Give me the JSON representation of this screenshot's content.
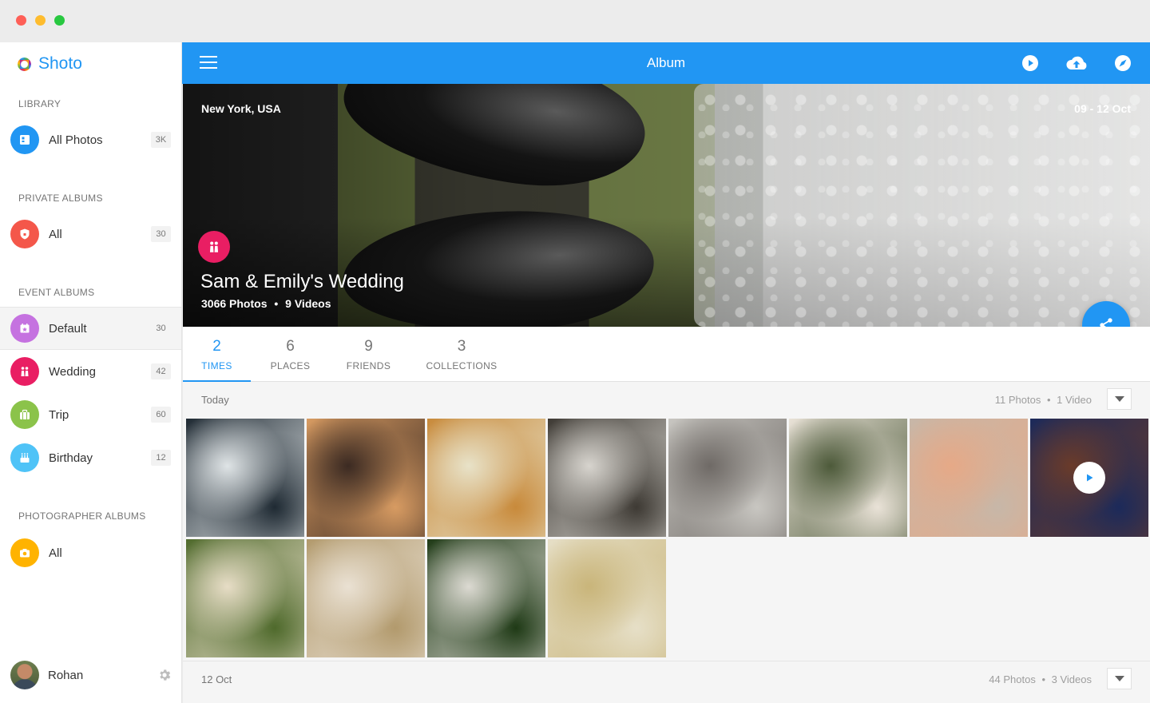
{
  "app": {
    "name": "Shoto"
  },
  "sidebar": {
    "sections": [
      {
        "label": "LIBRARY"
      },
      {
        "label": "PRIVATE ALBUMS"
      },
      {
        "label": "EVENT ALBUMS"
      },
      {
        "label": "PHOTOGRAPHER ALBUMS"
      }
    ],
    "items": [
      {
        "label": "All Photos",
        "count": "3K",
        "icon": "photos-icon",
        "color": "#2196f3"
      },
      {
        "label": "All",
        "count": "30",
        "icon": "shield-lock-icon",
        "color": "#f4574a"
      },
      {
        "label": "Default",
        "count": "30",
        "icon": "calendar-star-icon",
        "color": "#c572e0"
      },
      {
        "label": "Wedding",
        "count": "42",
        "icon": "couple-icon",
        "color": "#e91e63"
      },
      {
        "label": "Trip",
        "count": "60",
        "icon": "suitcase-icon",
        "color": "#8bc34a"
      },
      {
        "label": "Birthday",
        "count": "12",
        "icon": "cake-icon",
        "color": "#4fc3f7"
      },
      {
        "label": "All",
        "count": "",
        "icon": "camera-icon",
        "color": "#ffb300"
      }
    ],
    "user": {
      "name": "Rohan"
    }
  },
  "appbar": {
    "title": "Album",
    "icons": [
      "play-circle-icon",
      "cloud-upload-icon",
      "compass-icon"
    ]
  },
  "hero": {
    "location": "New York, USA",
    "date": "09 - 12 Oct",
    "title": "Sam & Emily's Wedding",
    "photos": "3066 Photos",
    "separator": "•",
    "videos": "9 Videos"
  },
  "tabs": [
    {
      "num": "2",
      "label": "TIMES",
      "active": true
    },
    {
      "num": "6",
      "label": "PLACES"
    },
    {
      "num": "9",
      "label": "FRIENDS"
    },
    {
      "num": "3",
      "label": "COLLECTIONS"
    }
  ],
  "groups": [
    {
      "title": "Today",
      "photos": "11 Photos",
      "sep": "•",
      "videos": "1 Video"
    },
    {
      "title": "12 Oct",
      "photos": "44 Photos",
      "sep": "•",
      "videos": "3 Videos"
    }
  ],
  "photos": [
    {
      "name": "groom-suit-boutonniere",
      "c1": "#1f2a33",
      "c2": "#dfe4e6"
    },
    {
      "name": "couple-sunset-field",
      "c1": "#d79b62",
      "c2": "#3b2a22"
    },
    {
      "name": "friends-cheers-beer",
      "c1": "#c88a3b",
      "c2": "#e8e2c8"
    },
    {
      "name": "lace-dress-back",
      "c1": "#3e3a34",
      "c2": "#d7d4ce"
    },
    {
      "name": "couple-walking-stairs",
      "c1": "#c8c6c1",
      "c2": "#6f6a66"
    },
    {
      "name": "bride-beach",
      "c1": "#e9e2d7",
      "c2": "#4d5a3a"
    },
    {
      "name": "rings-hands-bouquet",
      "c1": "#c7b7a8",
      "c2": "#e6a987"
    },
    {
      "name": "reception-table-video",
      "c1": "#1c2a5a",
      "c2": "#6a3b2a",
      "video": true
    },
    {
      "name": "couple-feet-grass",
      "c1": "#4f6a2c",
      "c2": "#e7ddc6"
    },
    {
      "name": "couple-embrace-lace",
      "c1": "#b29a6d",
      "c2": "#eae1d3"
    },
    {
      "name": "couple-forest",
      "c1": "#1f3a16",
      "c2": "#dcdad2"
    },
    {
      "name": "couple-field-barn",
      "c1": "#e6dfc7",
      "c2": "#c9b57a"
    }
  ]
}
